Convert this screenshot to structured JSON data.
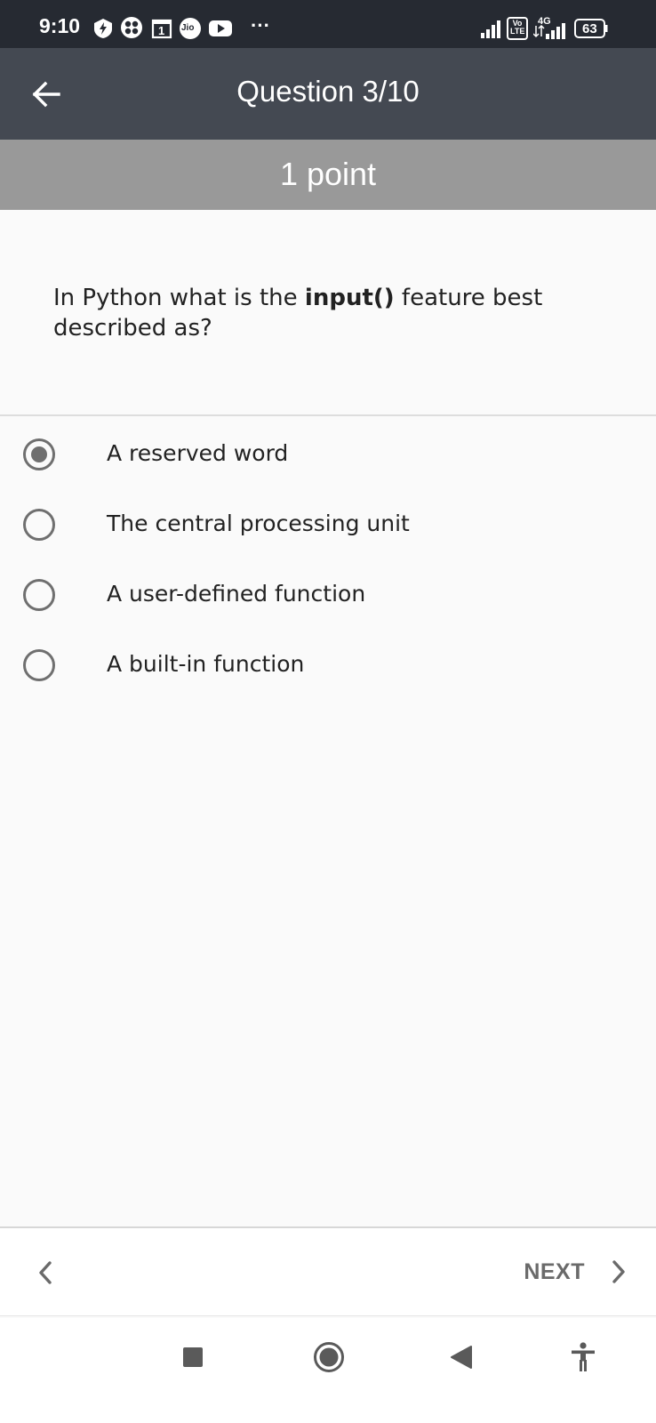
{
  "status_bar": {
    "time": "9:10",
    "battery": "63",
    "network": "4G",
    "volte": "Vo LTE",
    "jio": "Jio",
    "calendar_day": "1",
    "more": "···"
  },
  "app_bar": {
    "title": "Question 3/10"
  },
  "points": {
    "label": "1 point"
  },
  "question": {
    "prefix": "In Python what is the ",
    "bold": "input()",
    "suffix": " feature best described as?"
  },
  "options": [
    {
      "label": "A reserved word",
      "selected": true
    },
    {
      "label": "The central processing unit",
      "selected": false
    },
    {
      "label": "A user-defined function",
      "selected": false
    },
    {
      "label": "A built-in function",
      "selected": false
    }
  ],
  "bottom_nav": {
    "next_label": "NEXT"
  },
  "colors": {
    "status_bar": "#262a32",
    "app_bar": "#444952",
    "points_band": "#999999",
    "radio": "#6f6f6f"
  }
}
